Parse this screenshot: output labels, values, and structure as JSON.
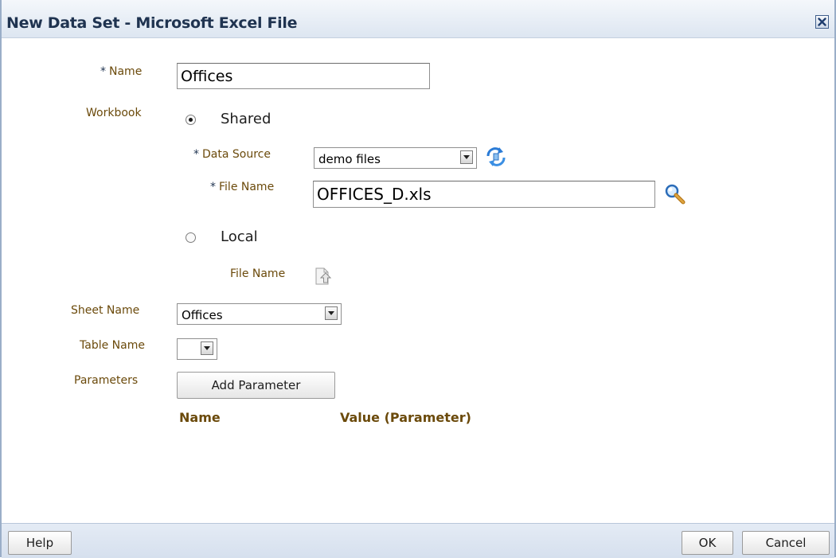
{
  "dialog": {
    "title": "New Data Set - Microsoft Excel File"
  },
  "form": {
    "required_mark": "*",
    "name_label": "Name",
    "name_value": "Offices",
    "workbook_label": "Workbook",
    "shared_label": "Shared",
    "shared_selected": true,
    "data_source_label": "Data Source",
    "data_source_value": "demo files",
    "file_name_label": "File Name",
    "file_name_value": "OFFICES_D.xls",
    "local_label": "Local",
    "local_file_name_label": "File Name",
    "sheet_name_label": "Sheet Name",
    "sheet_name_value": "Offices",
    "table_name_label": "Table Name",
    "table_name_value": "",
    "parameters_label": "Parameters",
    "add_parameter_label": "Add Parameter"
  },
  "parameters_table": {
    "columns": [
      "Name",
      "Value (Parameter)"
    ]
  },
  "footer": {
    "help_label": "Help",
    "ok_label": "OK",
    "cancel_label": "Cancel"
  },
  "colors": {
    "label": "#6b4a0b",
    "title": "#1f3350",
    "titlebar": "#dde6f1",
    "footer": "#d6e0ee"
  }
}
